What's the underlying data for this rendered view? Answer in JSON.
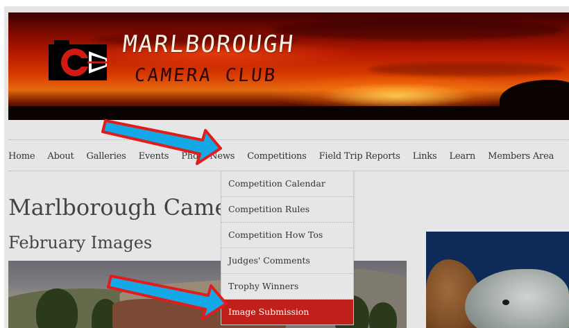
{
  "banner": {
    "line1": "MARLBOROUGH",
    "line2": "CAMERA CLUB"
  },
  "nav": {
    "items": [
      "Home",
      "About",
      "Galleries",
      "Events",
      "Photo News",
      "Competitions",
      "Field Trip Reports",
      "Links",
      "Learn",
      "Members Area"
    ]
  },
  "dropdown": {
    "items": [
      "Competition Calendar",
      "Competition Rules",
      "Competition How Tos",
      "Judges' Comments",
      "Trophy Winners",
      "Image Submission"
    ],
    "active_index": 5
  },
  "page": {
    "title": "Marlborough Camera Club",
    "section": "February Images"
  },
  "colors": {
    "active_menu": "#c0201a",
    "arrow_fill": "#15a8e6",
    "arrow_stroke": "#e21b1b",
    "background": "#e6e6e6"
  },
  "icons": {
    "logo": "camera-c-logo-icon",
    "annotation": "arrow-pointer-icon"
  }
}
